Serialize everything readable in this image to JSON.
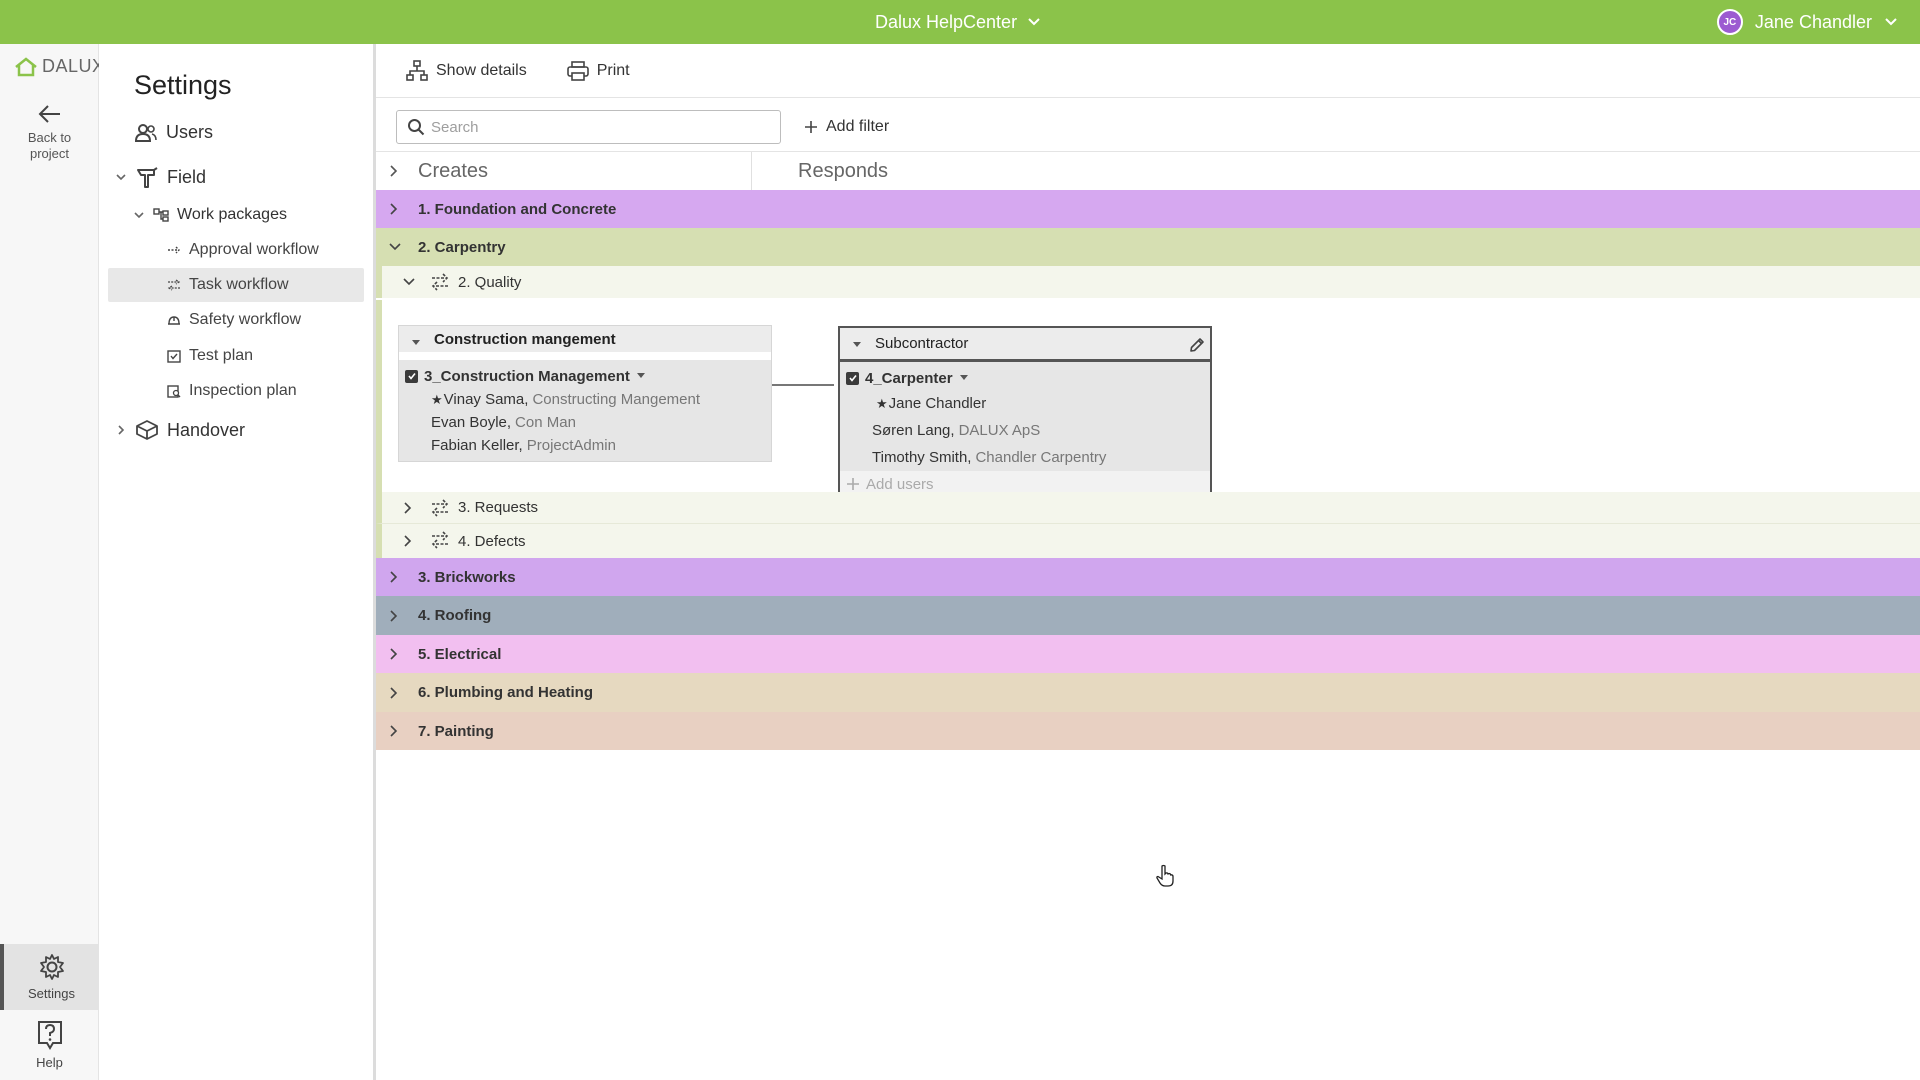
{
  "topbar": {
    "app_title": "Dalux HelpCenter",
    "user_initials": "JC",
    "user_name": "Jane Chandler"
  },
  "rail": {
    "logo_text": "DALUX",
    "back_label_1": "Back to",
    "back_label_2": "project",
    "settings_label": "Settings",
    "help_label": "Help"
  },
  "nav": {
    "title": "Settings",
    "users": "Users",
    "field": "Field",
    "work_packages": "Work packages",
    "approval_workflow": "Approval workflow",
    "task_workflow": "Task workflow",
    "safety_workflow": "Safety workflow",
    "test_plan": "Test plan",
    "inspection_plan": "Inspection plan",
    "handover": "Handover"
  },
  "toolbar": {
    "show_details": "Show details",
    "print": "Print"
  },
  "filter": {
    "search_placeholder": "Search",
    "add_filter": "Add filter"
  },
  "columns": {
    "creates": "Creates",
    "responds": "Responds"
  },
  "packages": [
    {
      "label": "1. Foundation and Concrete",
      "color": "#d6a8f0"
    },
    {
      "label": "2. Carpentry",
      "color": "#d6dfb2"
    },
    {
      "label": "3. Brickworks",
      "color": "#d0a6ee"
    },
    {
      "label": "4. Roofing",
      "color": "#a0aebb"
    },
    {
      "label": "5. Electrical",
      "color": "#f2bff0"
    },
    {
      "label": "6. Plumbing and Heating",
      "color": "#e6d9c0"
    },
    {
      "label": "7. Painting",
      "color": "#e8d0c2"
    }
  ],
  "subflows": {
    "quality": "2. Quality",
    "requests": "3. Requests",
    "defects": "4. Defects"
  },
  "creates_card": {
    "title": "Construction mangement",
    "group": "3_Construction Management",
    "people": [
      {
        "name": "Vinay Sama,",
        "company": "Constructing Mangement"
      },
      {
        "name": "Evan Boyle,",
        "company": "Con Man"
      },
      {
        "name": "Fabian Keller,",
        "company": "ProjectAdmin"
      }
    ]
  },
  "responds_card": {
    "title": "Subcontractor",
    "group": "4_Carpenter",
    "people": [
      {
        "name": "Jane Chandler",
        "company": ""
      },
      {
        "name": "Søren Lang,",
        "company": "DALUX ApS"
      },
      {
        "name": "Timothy Smith,",
        "company": "Chandler Carpentry"
      }
    ],
    "add_users": "Add users"
  }
}
